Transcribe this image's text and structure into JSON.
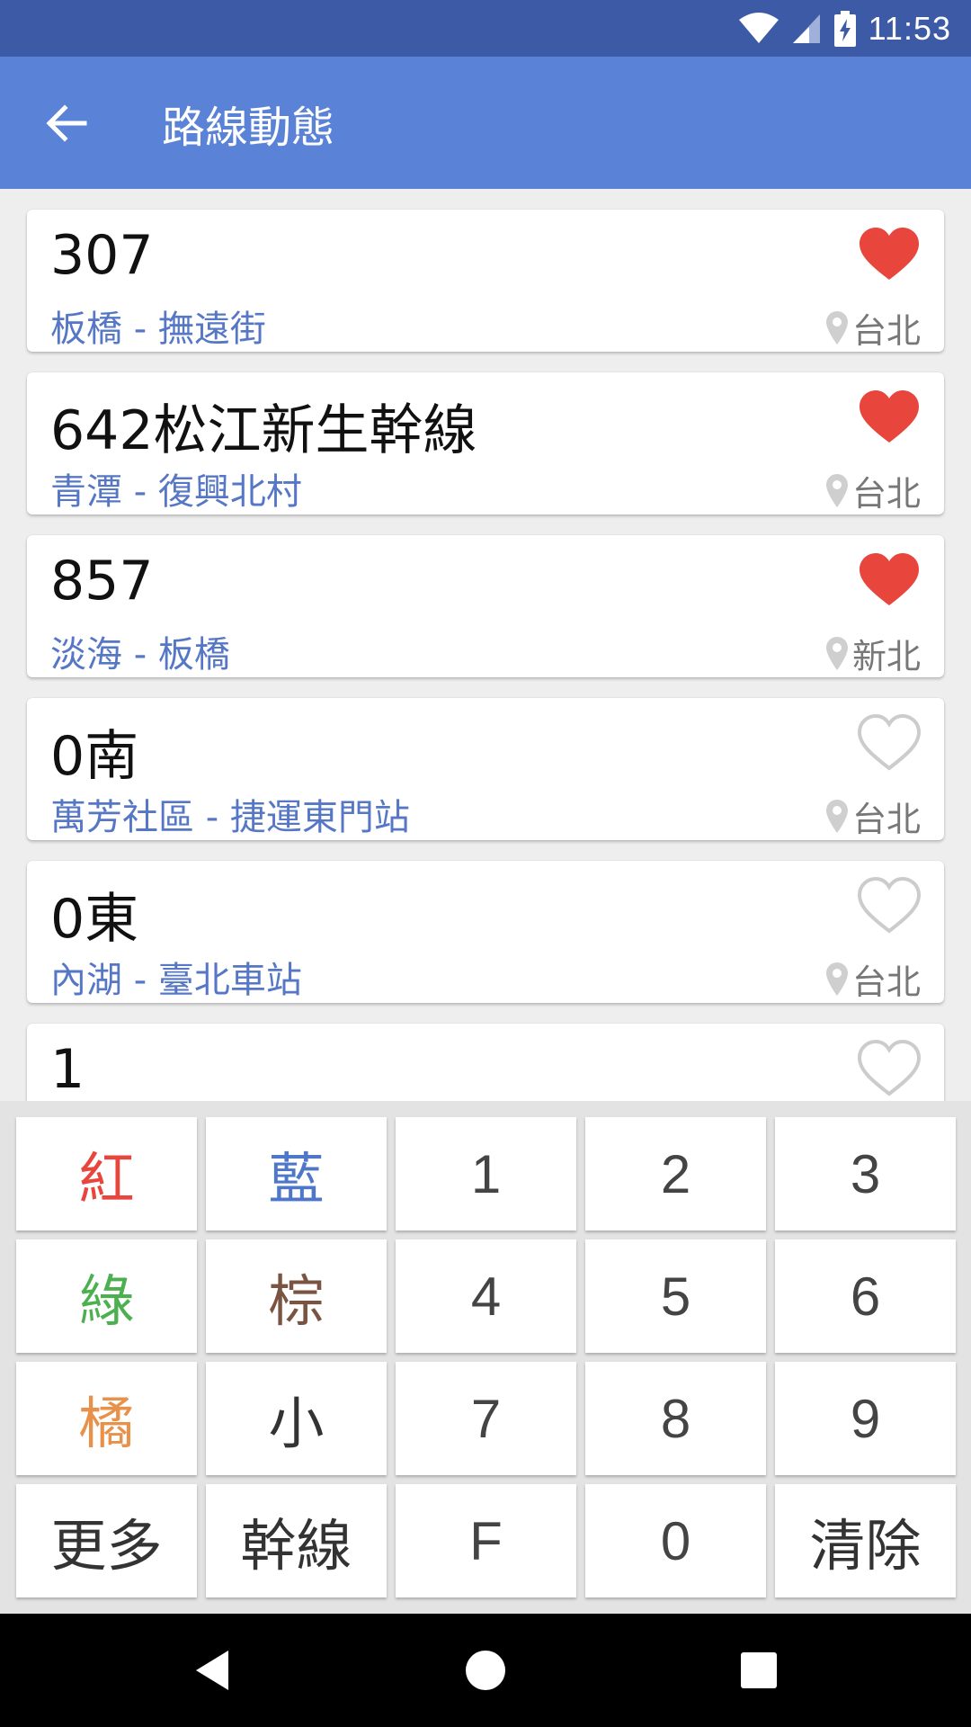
{
  "status_bar": {
    "time": "11:53"
  },
  "app_bar": {
    "title": "路線動態"
  },
  "routes": [
    {
      "name": "307",
      "desc": "板橋 - 撫遠街",
      "region": "台北",
      "favorite": true
    },
    {
      "name": "642松江新生幹線",
      "desc": "青潭 - 復興北村",
      "region": "台北",
      "favorite": true
    },
    {
      "name": "857",
      "desc": "淡海 - 板橋",
      "region": "新北",
      "favorite": true
    },
    {
      "name": "0南",
      "desc": "萬芳社區 - 捷運東門站",
      "region": "台北",
      "favorite": false
    },
    {
      "name": "0東",
      "desc": "內湖 - 臺北車站",
      "region": "台北",
      "favorite": false
    },
    {
      "name": "1",
      "desc": "",
      "region": "",
      "favorite": false
    }
  ],
  "keypad": {
    "keys": [
      [
        "紅",
        "藍",
        "1",
        "2",
        "3"
      ],
      [
        "綠",
        "棕",
        "4",
        "5",
        "6"
      ],
      [
        "橘",
        "小",
        "7",
        "8",
        "9"
      ],
      [
        "更多",
        "幹線",
        "F",
        "0",
        "清除"
      ]
    ]
  },
  "colors": {
    "status_bar": "#3d5aa6",
    "app_bar": "#5a82d6",
    "route_desc": "#5677c6",
    "heart_filled": "#e8453c",
    "heart_outline": "#cccccc",
    "key_red": "#e8453c",
    "key_blue": "#4f77c9",
    "key_green": "#4caf50",
    "key_brown": "#7a5443",
    "key_orange": "#e8914a"
  },
  "icons": {
    "back": "arrow-left-icon",
    "wifi": "wifi-icon",
    "signal": "signal-icon",
    "battery": "battery-charging-icon",
    "favorite": "heart-icon",
    "location": "location-pin-icon",
    "nav_back": "triangle-back-icon",
    "nav_home": "circle-home-icon",
    "nav_recent": "square-recent-icon"
  }
}
